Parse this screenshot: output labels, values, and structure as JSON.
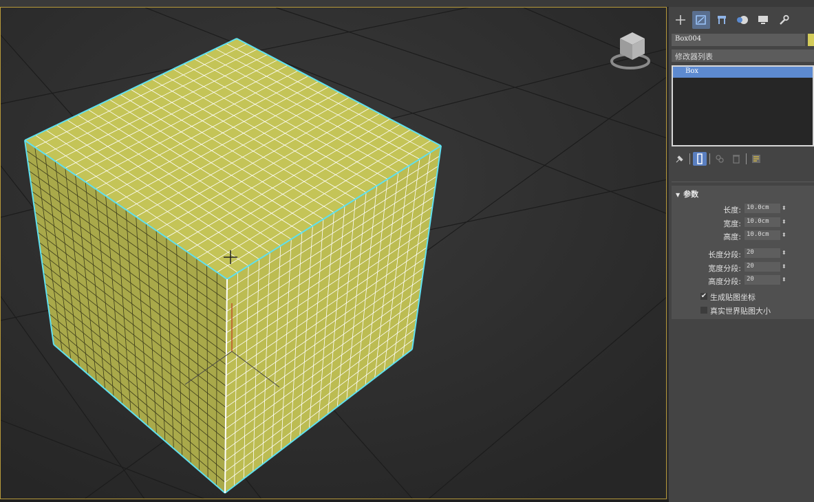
{
  "command_panel": {
    "tabs": [
      {
        "icon": "create-plus-icon",
        "active": false
      },
      {
        "icon": "modify-icon",
        "active": true
      },
      {
        "icon": "hierarchy-icon",
        "active": false
      },
      {
        "icon": "motion-icon",
        "active": false
      },
      {
        "icon": "display-icon",
        "active": false
      },
      {
        "icon": "utilities-wrench-icon",
        "active": false
      }
    ],
    "object_name": "Box004",
    "object_color": "#d4cc5a",
    "modifier_list_label": "修改器列表",
    "stack_items": [
      "Box"
    ],
    "stack_tools": [
      "pin-stack-icon",
      "show-end-result-icon",
      "make-unique-icon",
      "remove-modifier-icon",
      "configure-sets-icon"
    ]
  },
  "parameters": {
    "header": "参数",
    "length_label": "长度:",
    "length_value": "10.0cm",
    "width_label": "宽度:",
    "width_value": "10.0cm",
    "height_label": "高度:",
    "height_value": "10.0cm",
    "length_segs_label": "长度分段:",
    "length_segs_value": "20",
    "width_segs_label": "宽度分段:",
    "width_segs_value": "20",
    "height_segs_label": "高度分段:",
    "height_segs_value": "20",
    "gen_mapping_label": "生成贴图坐标",
    "gen_mapping_checked": true,
    "real_world_label": "真实世界贴图大小",
    "real_world_checked": false
  },
  "viewport": {
    "cube_color": "#c4c457",
    "selection_color": "#5fe0f0",
    "border_color": "#b89a3a"
  }
}
